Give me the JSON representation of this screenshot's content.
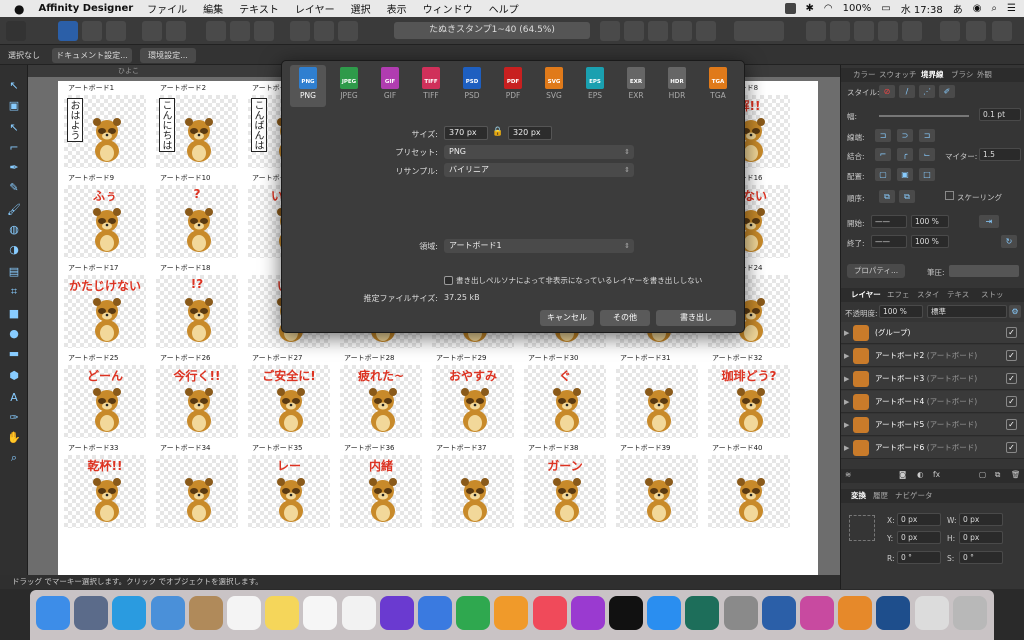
{
  "menubar": {
    "app": "Affinity Designer",
    "items": [
      "ファイル",
      "編集",
      "テキスト",
      "レイヤー",
      "選択",
      "表示",
      "ウィンドウ",
      "ヘルプ"
    ],
    "battery": "100%",
    "clock": "水 17:38",
    "input": "あ"
  },
  "toolbar": {
    "doc_title": "たぬきスタンプ1~40 (64.5%)"
  },
  "context": {
    "select_none": "選択なし",
    "doc_setup": "ドキュメント設定...",
    "prefs": "環境設定..."
  },
  "ruler": {
    "label": "ひよこ"
  },
  "artboards": [
    {
      "label": "アートボード1",
      "caption": "おはよう",
      "vertical": true
    },
    {
      "label": "アートボード2",
      "caption": "こんにちは",
      "vertical": true
    },
    {
      "label": "アートボード3",
      "caption": "こんばんは",
      "vertical": true
    },
    {
      "label": "アートボード4",
      "caption": ""
    },
    {
      "label": "アートボード5",
      "caption": ""
    },
    {
      "label": "アートボード6",
      "caption": ""
    },
    {
      "label": "アートボード7",
      "caption": ""
    },
    {
      "label": "アートボード8",
      "caption": "解!!"
    },
    {
      "label": "アートボード9",
      "caption": "ふぅ"
    },
    {
      "label": "アートボード10",
      "caption": "?"
    },
    {
      "label": "アートボード11",
      "caption": "いつで"
    },
    {
      "label": "",
      "caption": ""
    },
    {
      "label": "",
      "caption": ""
    },
    {
      "label": "",
      "caption": ""
    },
    {
      "label": "",
      "caption": ""
    },
    {
      "label": "アートボード16",
      "caption": "訳ない"
    },
    {
      "label": "アートボード17",
      "caption": "かたじけない"
    },
    {
      "label": "アートボード18",
      "caption": "!?"
    },
    {
      "label": "",
      "caption": "いた"
    },
    {
      "label": "",
      "caption": ""
    },
    {
      "label": "",
      "caption": ""
    },
    {
      "label": "",
      "caption": ""
    },
    {
      "label": "",
      "caption": ""
    },
    {
      "label": "アートボード24",
      "caption": ""
    },
    {
      "label": "アートボード25",
      "caption": "どーん"
    },
    {
      "label": "アートボード26",
      "caption": "今行く!!"
    },
    {
      "label": "アートボード27",
      "caption": "ご安全に!"
    },
    {
      "label": "アートボード28",
      "caption": "疲れた~"
    },
    {
      "label": "アートボード29",
      "caption": "おやすみ"
    },
    {
      "label": "アートボード30",
      "caption": "ぐ"
    },
    {
      "label": "アートボード31",
      "caption": ""
    },
    {
      "label": "アートボード32",
      "caption": "珈琲どう?"
    },
    {
      "label": "アートボード33",
      "caption": "乾杯!!"
    },
    {
      "label": "アートボード34",
      "caption": ""
    },
    {
      "label": "アートボード35",
      "caption": "レー"
    },
    {
      "label": "アートボード36",
      "caption": "内緒"
    },
    {
      "label": "アートボード37",
      "caption": ""
    },
    {
      "label": "アートボード38",
      "caption": "ガーン"
    },
    {
      "label": "アートボード39",
      "caption": ""
    },
    {
      "label": "アートボード40",
      "caption": ""
    }
  ],
  "export": {
    "formats": [
      {
        "name": "PNG",
        "color": "#2f7fd0"
      },
      {
        "name": "JPEG",
        "color": "#2e9a4a"
      },
      {
        "name": "GIF",
        "color": "#b03cb0"
      },
      {
        "name": "TIFF",
        "color": "#d0305a"
      },
      {
        "name": "PSD",
        "color": "#1e5fc0"
      },
      {
        "name": "PDF",
        "color": "#c82020"
      },
      {
        "name": "SVG",
        "color": "#e07a1a"
      },
      {
        "name": "EPS",
        "color": "#1aa0b0"
      },
      {
        "name": "EXR",
        "color": "#666666"
      },
      {
        "name": "HDR",
        "color": "#666666"
      },
      {
        "name": "TGA",
        "color": "#e07a1a"
      }
    ],
    "size_label": "サイズ:",
    "width": "370 px",
    "height": "320 px",
    "preset_label": "プリセット:",
    "preset": "PNG",
    "resample_label": "リサンプル:",
    "resample": "バイリニア",
    "area_label": "領域:",
    "area": "アートボード1",
    "checkbox_label": "書き出しペルソナによって非表示になっているレイヤーを書き出ししない",
    "estsize_label": "推定ファイルサイズ:",
    "estsize": "37.25 kB",
    "cancel": "キャンセル",
    "other": "その他",
    "export": "書き出し"
  },
  "status": {
    "text": "ドラッグ でマーキー選択します。クリック でオブジェクトを選択します。"
  },
  "panel": {
    "tabs1": [
      "カラー",
      "スウォッチ",
      "境界線",
      "ブラシ",
      "外観"
    ],
    "style_label": "スタイル:",
    "width_label": "幅:",
    "width_value": "0.1 pt",
    "cap_label": "線端:",
    "join_label": "結合:",
    "align_label": "配置:",
    "miter_label": "マイター:",
    "miter_value": "1.5",
    "order_label": "順序:",
    "scale_label": "スケーリング",
    "start_label": "開始:",
    "end_label": "終了:",
    "pct": "100 %",
    "props_btn": "プロパティ...",
    "pressure_label": "筆圧:",
    "tabs2": [
      "レイヤー",
      "エフェ",
      "スタイ",
      "テキス",
      "ストッ"
    ],
    "opacity_label": "不透明度:",
    "opacity_value": "100 %",
    "blend": "標準",
    "layers": [
      {
        "name": "(グループ)",
        "type": ""
      },
      {
        "name": "アートボード2",
        "type": "(アートボード)"
      },
      {
        "name": "アートボード3",
        "type": "(アートボード)"
      },
      {
        "name": "アートボード4",
        "type": "(アートボード)"
      },
      {
        "name": "アートボード5",
        "type": "(アートボード)"
      },
      {
        "name": "アートボード6",
        "type": "(アートボード)"
      }
    ],
    "tabs3": [
      "変換",
      "履歴",
      "ナビゲータ"
    ],
    "x_label": "X:",
    "y_label": "Y:",
    "w_label": "W:",
    "h_label": "H:",
    "r_label": "R:",
    "s_label": "S:",
    "x": "0 px",
    "y": "0 px",
    "w": "0 px",
    "h": "0 px",
    "r": "0 °",
    "s": "0 °"
  },
  "dock": [
    {
      "name": "finder",
      "color": "#3d8de8"
    },
    {
      "name": "launchpad",
      "color": "#5b6b8a"
    },
    {
      "name": "safari",
      "color": "#2a9be0"
    },
    {
      "name": "mail",
      "color": "#4a90d9"
    },
    {
      "name": "contacts",
      "color": "#b08a5a"
    },
    {
      "name": "calendar",
      "color": "#f4f4f4"
    },
    {
      "name": "notes",
      "color": "#f5d65a"
    },
    {
      "name": "reminders",
      "color": "#f6f6f6"
    },
    {
      "name": "photos",
      "color": "#f2f2f2"
    },
    {
      "name": "imovie",
      "color": "#6a3ad0"
    },
    {
      "name": "keynote",
      "color": "#3a7ae0"
    },
    {
      "name": "numbers",
      "color": "#2fa84f"
    },
    {
      "name": "pages",
      "color": "#f09a2a"
    },
    {
      "name": "music",
      "color": "#f04a5a"
    },
    {
      "name": "podcasts",
      "color": "#9a3ad0"
    },
    {
      "name": "tv",
      "color": "#111111"
    },
    {
      "name": "appstore",
      "color": "#2a8ef0"
    },
    {
      "name": "timemachine",
      "color": "#1d6e5a"
    },
    {
      "name": "prefs",
      "color": "#8a8a8a"
    },
    {
      "name": "affinity-designer",
      "color": "#2b5fa8"
    },
    {
      "name": "affinity-photo",
      "color": "#c84aa0"
    },
    {
      "name": "blender",
      "color": "#e6892a"
    },
    {
      "name": "affinity-designer-beta",
      "color": "#1e4e8c"
    },
    {
      "name": "preview",
      "color": "#dcdcdc"
    },
    {
      "name": "trash",
      "color": "#b8b8b8"
    }
  ]
}
